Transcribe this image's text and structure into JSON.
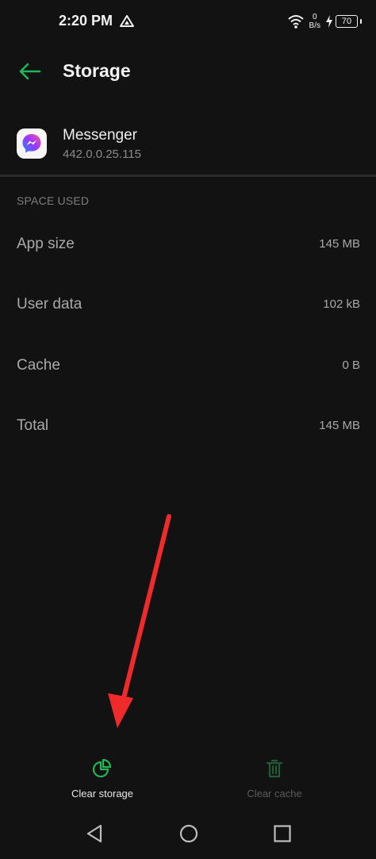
{
  "status_bar": {
    "time": "2:20 PM",
    "net_speed_value": "0",
    "net_speed_unit": "B/s",
    "battery": "70"
  },
  "toolbar": {
    "title": "Storage"
  },
  "app": {
    "name": "Messenger",
    "version": "442.0.0.25.115"
  },
  "section": {
    "label": "SPACE USED"
  },
  "rows": [
    {
      "label": "App size",
      "value": "145 MB"
    },
    {
      "label": "User data",
      "value": "102 kB"
    },
    {
      "label": "Cache",
      "value": "0 B"
    },
    {
      "label": "Total",
      "value": "145 MB"
    }
  ],
  "actions": {
    "clear_storage": "Clear storage",
    "clear_cache": "Clear cache"
  },
  "colors": {
    "accent": "#21b559",
    "disabled_accent": "#1f5c35",
    "annotation_arrow": "#ee2a2a"
  }
}
